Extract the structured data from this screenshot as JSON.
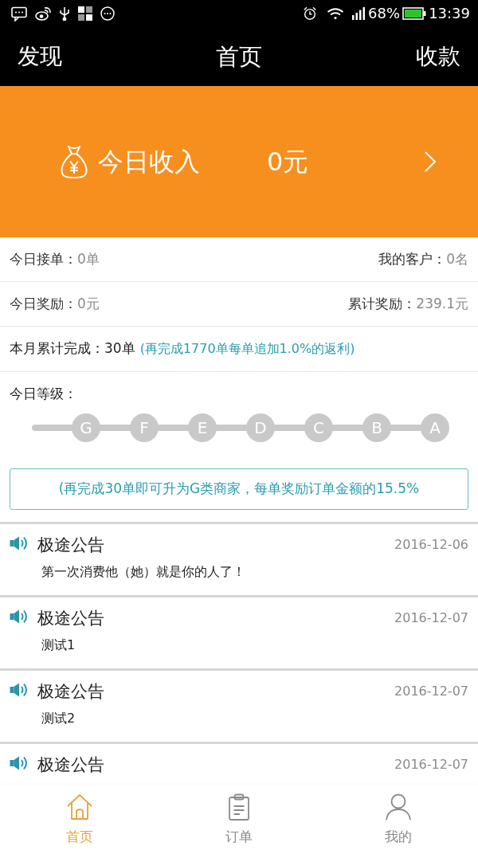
{
  "status_bar": {
    "battery_percent": "68%",
    "time": "13:39"
  },
  "nav_bar": {
    "left": "发现",
    "title": "首页",
    "right": "收款"
  },
  "income_banner": {
    "label": "今日收入",
    "amount": "0元"
  },
  "stats": [
    {
      "left_label": "今日接单：",
      "left_value": "0单",
      "right_label": "我的客户：",
      "right_value": "0名"
    },
    {
      "left_label": "今日奖励：",
      "left_value": "0元",
      "right_label": "累计奖励：",
      "right_value": "239.1元"
    }
  ],
  "monthly": {
    "text": "本月累计完成：30单",
    "hint": "(再完成1770单每单追加1.0%的返利)"
  },
  "level": {
    "label": "今日等级：",
    "grades": [
      "G",
      "F",
      "E",
      "D",
      "C",
      "B",
      "A"
    ]
  },
  "notice": "(再完成30单即可升为G类商家，每单奖励订单金额的15.5%",
  "announcements": [
    {
      "title": "极途公告",
      "date": "2016-12-06",
      "body": "第一次消费他（她）就是你的人了！"
    },
    {
      "title": "极途公告",
      "date": "2016-12-07",
      "body": "测试1"
    },
    {
      "title": "极途公告",
      "date": "2016-12-07",
      "body": "测试2"
    },
    {
      "title": "极途公告",
      "date": "2016-12-07"
    }
  ],
  "tab_bar": [
    {
      "kind": "home",
      "label": "首页",
      "selected": true
    },
    {
      "kind": "orders",
      "label": "订单",
      "selected": false
    },
    {
      "kind": "profile",
      "label": "我的",
      "selected": false
    }
  ]
}
